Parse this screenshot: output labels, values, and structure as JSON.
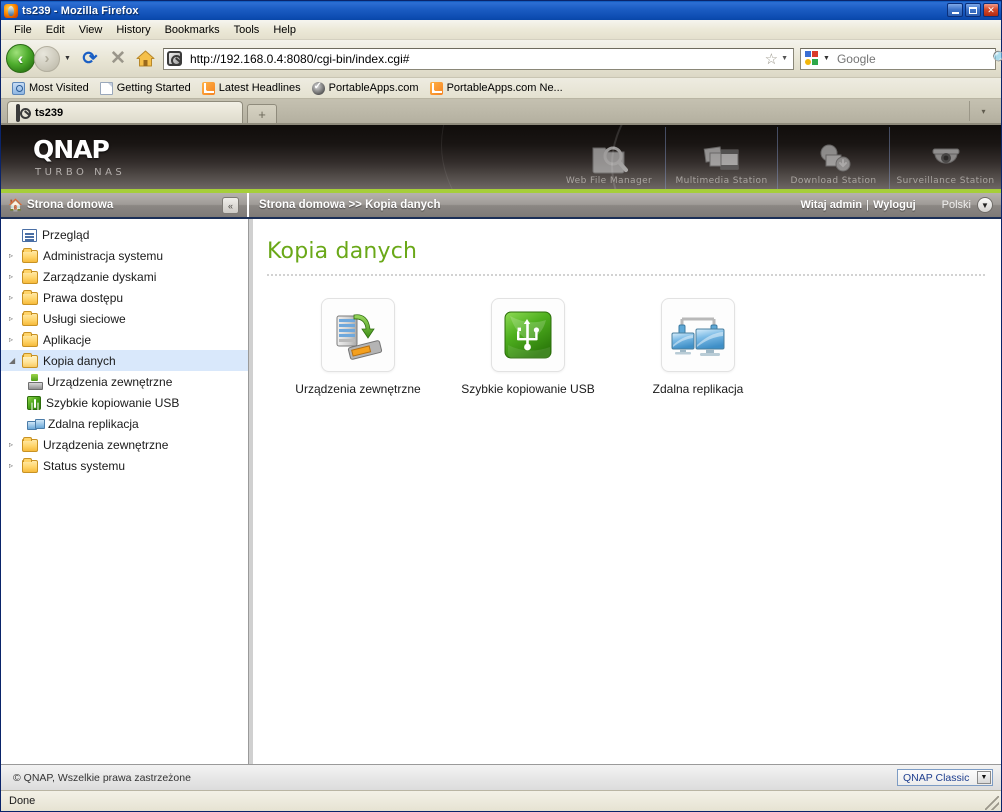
{
  "window": {
    "title": "ts239 - Mozilla Firefox",
    "icon": "firefox-icon",
    "minimize_label": "",
    "maximize_label": "",
    "close_label": "✕"
  },
  "menubar": {
    "items": [
      {
        "label": "File"
      },
      {
        "label": "Edit"
      },
      {
        "label": "View"
      },
      {
        "label": "History"
      },
      {
        "label": "Bookmarks"
      },
      {
        "label": "Tools"
      },
      {
        "label": "Help"
      }
    ]
  },
  "toolbar": {
    "back_glyph": "‹",
    "forward_glyph": "›",
    "history_drop_glyph": "▼",
    "reload_glyph": "⟳",
    "stop_glyph": "✕",
    "home_glyph": "🏠",
    "url_value": "http://192.168.0.4:8080/cgi-bin/index.cgi#",
    "url_placeholder": "",
    "bookmark_star_glyph": "☆",
    "url_drop_glyph": "▼",
    "search_placeholder": "Google",
    "search_value": "",
    "search_drop_glyph": "▼",
    "search_glyph": "🔍"
  },
  "bookmarks": {
    "items": [
      {
        "label": "Most Visited",
        "icon": "most-visited-icon",
        "kind": "blue"
      },
      {
        "label": "Getting Started",
        "icon": "page-icon",
        "kind": "page"
      },
      {
        "label": "Latest Headlines",
        "icon": "rss-icon",
        "kind": "rss"
      },
      {
        "label": "PortableApps.com",
        "icon": "portableapps-icon",
        "kind": "pa"
      },
      {
        "label": "PortableApps.com Ne...",
        "icon": "rss-icon",
        "kind": "rss"
      }
    ]
  },
  "tabs": {
    "items": [
      {
        "label": "ts239",
        "icon": "qnap-favicon"
      }
    ],
    "new_tab_glyph": "+",
    "list_all_glyph": "▾"
  },
  "banner": {
    "logo_primary": "QNAP",
    "logo_secondary": "TURBO NAS",
    "apps": [
      {
        "label": "Web File Manager",
        "icon": "folder-search-icon"
      },
      {
        "label": "Multimedia Station",
        "icon": "photos-film-icon"
      },
      {
        "label": "Download Station",
        "icon": "download-screen-icon"
      },
      {
        "label": "Surveillance Station",
        "icon": "dome-camera-icon"
      }
    ]
  },
  "subheader": {
    "home_label": "Strona domowa",
    "home_icon": "home-icon",
    "collapse_glyph": "«",
    "breadcrumb": "Strona domowa >> Kopia danych",
    "greeting": "Witaj admin",
    "greeting_separator": "|",
    "logout_label": "Wyloguj",
    "language": "Polski",
    "language_drop_glyph": "▼"
  },
  "sidebar": {
    "items": [
      {
        "label": "Przegląd",
        "icon": "overview-icon",
        "kind": "sheet",
        "expandable": false,
        "selected": false,
        "child": false
      },
      {
        "label": "Administracja systemu",
        "icon": "folder-icon",
        "kind": "folder",
        "expandable": true,
        "selected": false,
        "child": false
      },
      {
        "label": "Zarządzanie dyskami",
        "icon": "folder-icon",
        "kind": "folder",
        "expandable": true,
        "selected": false,
        "child": false
      },
      {
        "label": "Prawa dostępu",
        "icon": "folder-icon",
        "kind": "folder",
        "expandable": true,
        "selected": false,
        "child": false
      },
      {
        "label": "Usługi sieciowe",
        "icon": "folder-icon",
        "kind": "folder",
        "expandable": true,
        "selected": false,
        "child": false
      },
      {
        "label": "Aplikacje",
        "icon": "folder-icon",
        "kind": "folder",
        "expandable": true,
        "selected": false,
        "child": false
      },
      {
        "label": "Kopia danych",
        "icon": "folder-open-icon",
        "kind": "folder-open",
        "expandable": true,
        "expanded": true,
        "selected": true,
        "child": false
      },
      {
        "label": "Urządzenia zewnętrzne",
        "icon": "external-device-icon",
        "kind": "extdev",
        "expandable": false,
        "selected": false,
        "child": true
      },
      {
        "label": "Szybkie kopiowanie USB",
        "icon": "usb-icon",
        "kind": "usb",
        "expandable": false,
        "selected": false,
        "child": true
      },
      {
        "label": "Zdalna replikacja",
        "icon": "remote-replication-icon",
        "kind": "repl",
        "expandable": false,
        "selected": false,
        "child": true
      },
      {
        "label": "Urządzenia zewnętrzne",
        "icon": "folder-icon",
        "kind": "folder",
        "expandable": true,
        "selected": false,
        "child": false
      },
      {
        "label": "Status systemu",
        "icon": "folder-icon",
        "kind": "folder",
        "expandable": true,
        "selected": false,
        "child": false
      }
    ],
    "collapsed_arrow": "▹",
    "expanded_arrow": "◢"
  },
  "main": {
    "title": "Kopia danych",
    "tiles": [
      {
        "label": "Urządzenia zewnętrzne",
        "icon": "server-backup-icon"
      },
      {
        "label": "Szybkie kopiowanie USB",
        "icon": "usb-green-icon"
      },
      {
        "label": "Zdalna replikacja",
        "icon": "two-monitors-icon"
      }
    ]
  },
  "page_footer": {
    "copyright": "© QNAP, Wszelkie prawa zastrzeżone",
    "skin_selected": "QNAP Classic",
    "skin_drop_glyph": "▼"
  },
  "statusbar": {
    "text": "Done"
  },
  "colors": {
    "accent_green": "#a6ce39",
    "title_green": "#6aa818",
    "selection_blue": "#d9e8fb",
    "titlebar_blue": "#0a54b6"
  }
}
